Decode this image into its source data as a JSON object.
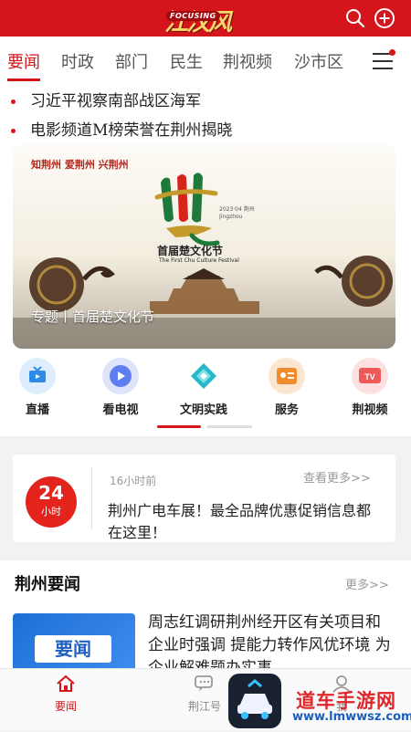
{
  "header": {
    "logo_main": "江汉风",
    "logo_sub": "FOCUSING"
  },
  "tabs": [
    "要闻",
    "时政",
    "部门",
    "民生",
    "荆视频",
    "沙市区"
  ],
  "scroll_news": [
    "习近平视察南部战区海军",
    "电影频道M榜荣誉在荆州揭晓"
  ],
  "banner": {
    "slogan": "知荆州 爱荆州 兴荆州",
    "fest_title": "首届楚文化节",
    "fest_en": "The First Chu Culture Festival",
    "fest_date": "2023·04 荆州",
    "fest_city": "Jingzhou",
    "caption": "专题丨首届楚文化节"
  },
  "shortcuts": [
    "直播",
    "看电视",
    "文明实践",
    "服务",
    "荆视频"
  ],
  "card24": {
    "badge_num": "24",
    "badge_unit": "小时",
    "time": "16小时前",
    "more": "查看更多>>",
    "title": "荆州广电车展！最全品牌优惠促销信息都在这里！"
  },
  "jingzhou_news": {
    "heading": "荆州要闻",
    "more": "更多>>",
    "thumb_label": "要闻",
    "title": "周志红调研荆州经开区有关项目和企业时强调 提能力转作风优环境 为企业解难题办实事"
  },
  "bottom_nav": [
    "要闻",
    "荆江号",
    "我"
  ],
  "watermark": {
    "text": "道车手游网",
    "url": "www.lmwwsz.com"
  },
  "colors": {
    "brand_red": "#d4161c",
    "badge_red": "#e2241c",
    "thumb_blue": "#1e6fd6"
  }
}
